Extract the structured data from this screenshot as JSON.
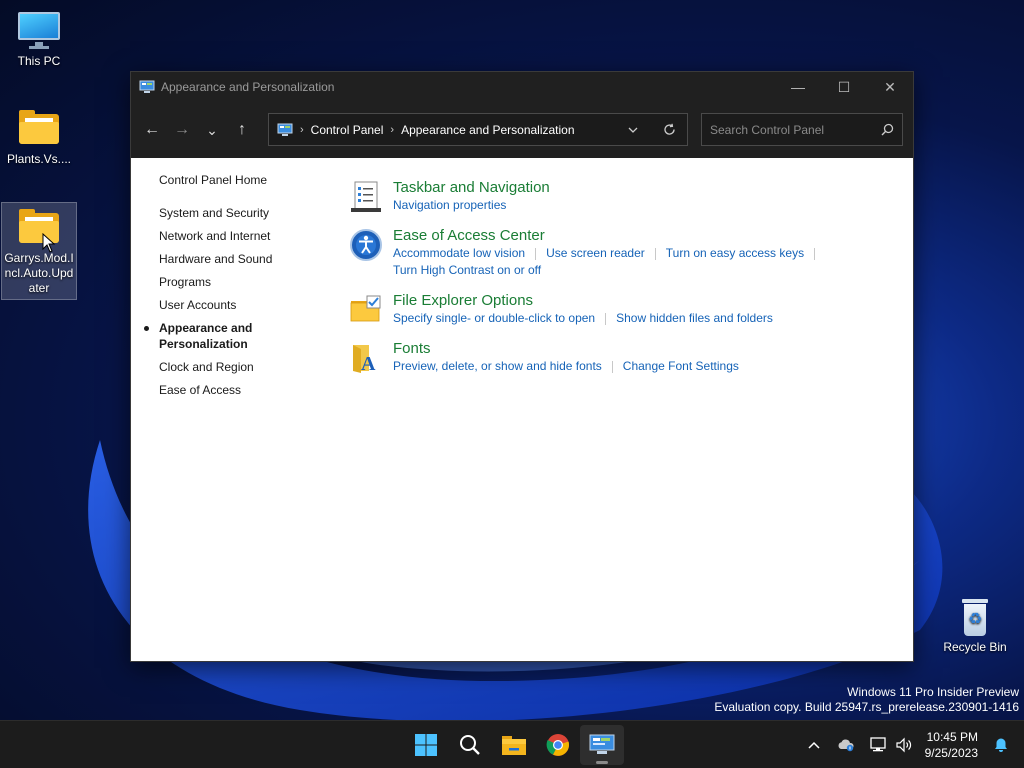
{
  "desktop": {
    "icons": [
      {
        "label": "This PC"
      },
      {
        "label": "Plants.Vs...."
      },
      {
        "label": "Garrys.Mod.Incl.Auto.Updater"
      },
      {
        "label": "Recycle Bin"
      }
    ],
    "watermark": {
      "line1": "Windows 11 Pro Insider Preview",
      "line2": "Evaluation copy. Build 25947.rs_prerelease.230901-1416"
    }
  },
  "window": {
    "title": "Appearance and Personalization",
    "controls": {
      "minimize": "—",
      "maximize": "☐",
      "close": "✕"
    },
    "nav": {
      "back": "←",
      "forward": "→",
      "recent": "⌄",
      "up": "↑"
    },
    "address": {
      "crumbs": [
        "Control Panel",
        "Appearance and Personalization"
      ],
      "separator": "›"
    },
    "search": {
      "placeholder": "Search Control Panel"
    },
    "sidebar": {
      "home": "Control Panel Home",
      "items": [
        "System and Security",
        "Network and Internet",
        "Hardware and Sound",
        "Programs",
        "User Accounts",
        "Appearance and Personalization",
        "Clock and Region",
        "Ease of Access"
      ]
    },
    "categories": [
      {
        "title": "Taskbar and Navigation",
        "links": [
          "Navigation properties"
        ]
      },
      {
        "title": "Ease of Access Center",
        "links": [
          "Accommodate low vision",
          "Use screen reader",
          "Turn on easy access keys",
          "Turn High Contrast on or off"
        ]
      },
      {
        "title": "File Explorer Options",
        "links": [
          "Specify single- or double-click to open",
          "Show hidden files and folders"
        ]
      },
      {
        "title": "Fonts",
        "links": [
          "Preview, delete, or show and hide fonts",
          "Change Font Settings"
        ]
      }
    ]
  },
  "taskbar": {
    "time": "10:45 PM",
    "date": "9/25/2023",
    "tray_chevron": "^"
  },
  "colors": {
    "category_title": "#1a7d35",
    "link": "#1663b7",
    "titlebar": "#202020"
  }
}
